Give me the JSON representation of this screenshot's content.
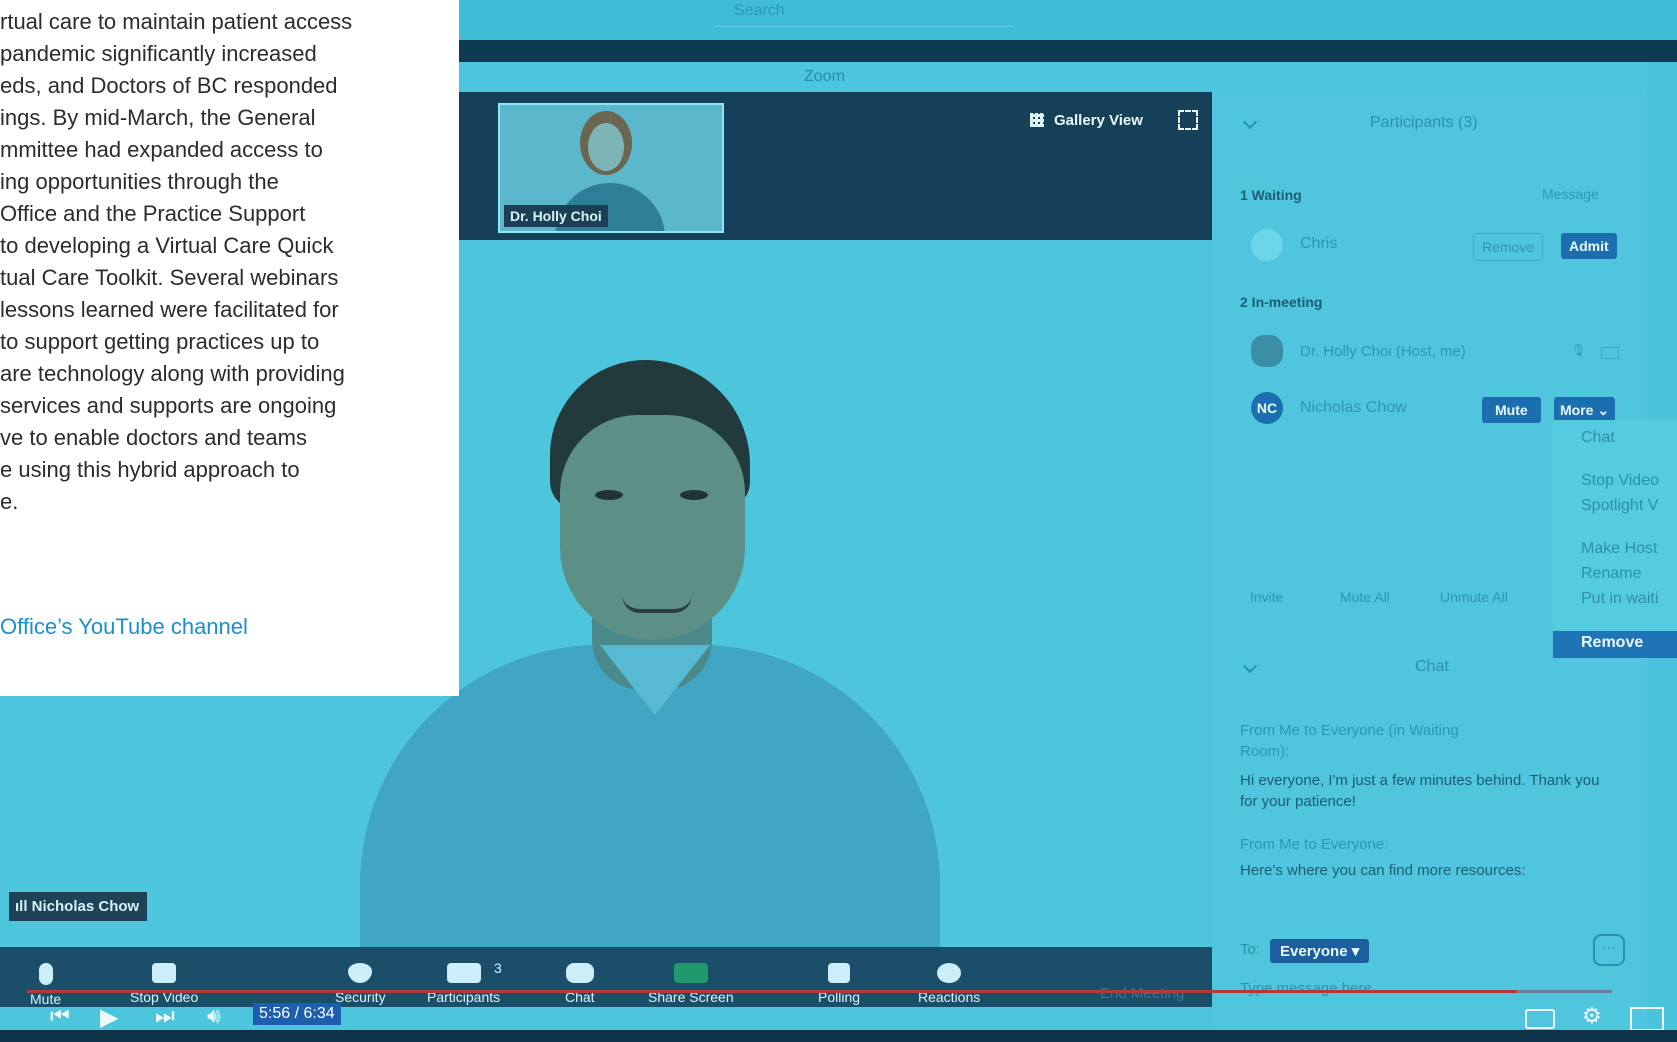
{
  "article": {
    "lines": [
      "rtual care to maintain patient access",
      "pandemic significantly increased",
      "eds, and Doctors of BC responded",
      "ings. By mid-March, the General",
      "mmittee had expanded access to",
      "ing opportunities through the",
      "Office and the Practice Support",
      "to developing a Virtual Care Quick",
      "tual Care Toolkit. Several webinars",
      "lessons learned were facilitated for",
      " to support getting practices up to",
      "are technology along with providing",
      "services and supports are ongoing",
      "ve to enable doctors and teams",
      "e using this hybrid approach to",
      "e."
    ],
    "link": "Office’s YouTube channel"
  },
  "browser": {
    "search_label": "Search"
  },
  "zoom": {
    "window_title": "Zoom",
    "thumbnail_name": "Dr. Holly Choi",
    "gallery_view": "Gallery View",
    "main_speaker": "Nicholas Chow",
    "toolbar": {
      "mute": "Mute",
      "stop_video": "Stop Video",
      "security": "Security",
      "participants": "Participants",
      "participants_count": "3",
      "chat": "Chat",
      "share_screen": "Share Screen",
      "polling": "Polling",
      "reactions": "Reactions",
      "end_meeting": "End Meeting"
    },
    "participants_panel": {
      "title": "Participants (3)",
      "waiting_header": "1 Waiting",
      "message": "Message",
      "waiting_person": "Chris",
      "remove": "Remove",
      "admit": "Admit",
      "in_meeting_header": "2 In-meeting",
      "host": "Dr. Holly Choi (Host, me)",
      "guest": "Nicholas Chow",
      "guest_initials": "NC",
      "mute": "Mute",
      "more": "More",
      "invite": "Invite",
      "mute_all": "Mute All",
      "unmute_all": "Unmute All"
    },
    "more_menu": [
      "Chat",
      "Stop Video",
      "Spotlight V",
      "Make Host",
      "Rename",
      "Put in waiti",
      "Remove"
    ],
    "chat_panel": {
      "title": "Chat",
      "msg1_from": "From Me to Everyone (in Waiting Room):",
      "msg1_text": "Hi everyone, I'm just a few minutes behind. Thank you for your patience!",
      "msg2_from": "From Me to Everyone:",
      "msg2_text": "Here's where you can find more resources:",
      "to_label": "To:",
      "recipient": "Everyone",
      "placeholder": "Type message here..."
    }
  },
  "player": {
    "time": "5:56 / 6:34",
    "progress_fraction": 0.94
  },
  "colors": {
    "tint": "#49c3dc",
    "zoom_blue": "#1b6fb0",
    "link": "#1b8fcf",
    "progress_red": "#b33a3a"
  }
}
